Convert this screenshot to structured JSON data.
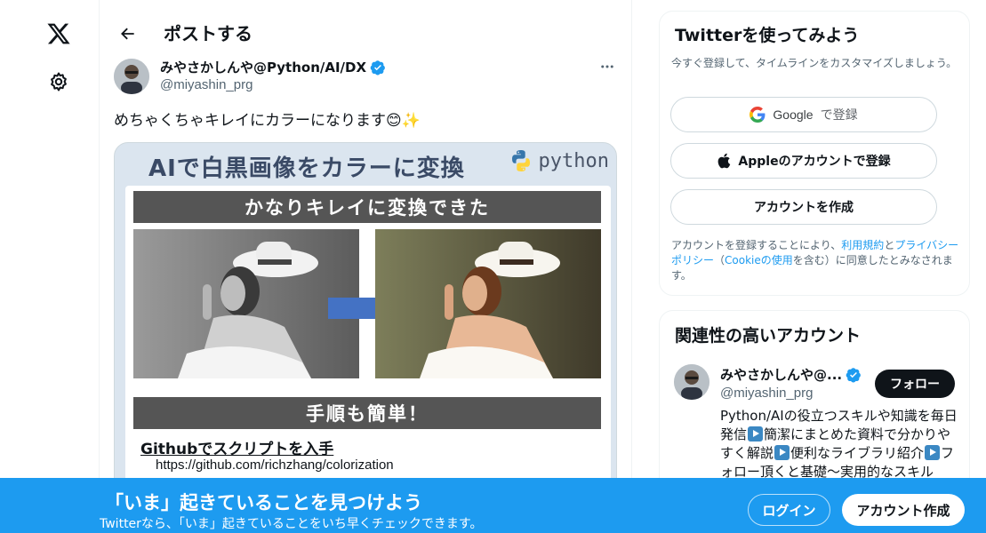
{
  "nav": {
    "logo_icon": "x-logo-icon",
    "settings_icon": "gear-icon"
  },
  "header": {
    "title": "ポストする",
    "back_icon": "arrow-left-icon"
  },
  "post": {
    "author_name": "みやさかしんや@Python/AI/DX",
    "author_handle": "@miyashin_prg",
    "verified": true,
    "text": "めちゃくちゃキレイにカラーになります😊✨",
    "media": {
      "title": "AIで白黒画像をカラーに変換",
      "python_label": "python",
      "banner_top": "かなりキレイに変換できた",
      "banner_bottom": "手順も簡単！",
      "github_title": "Githubでスクリプトを入手",
      "github_url": "https://github.com/richzhang/colorization"
    }
  },
  "signup_card": {
    "title": "Twitterを使ってみよう",
    "subtitle": "今すぐ登録して、タイムラインをカスタマイズしましょう。",
    "google_label": "Google",
    "google_suffix": "で登録",
    "apple_label": "Appleのアカウントで登録",
    "create_label": "アカウントを作成",
    "legal_prefix": "アカウントを登録することにより、",
    "terms_link": "利用規約",
    "and": "と",
    "privacy_link": "プライバシーポリシー",
    "paren_open": "（",
    "cookie_link": "Cookieの使用",
    "legal_suffix": "を含む）に同意したとみなされます。"
  },
  "related_card": {
    "title": "関連性の高いアカウント",
    "name": "みやさかしんや@...",
    "handle": "@miyashin_prg",
    "follow_label": "フォロー",
    "bio_1": "Python/AIの役立つスキルや知識を毎日発信",
    "bio_2": "簡潔にまとめた資料で分かりやすく解説",
    "bio_3": "便利なライブラリ紹介",
    "bio_4": "フォロー頂くと基礎〜実用的なスキル"
  },
  "bottom_bar": {
    "title": "「いま」起きていることを見つけよう",
    "subtitle": "Twitterなら、「いま」起きていることをいち早くチェックできます。",
    "login_label": "ログイン",
    "signup_label": "アカウント作成"
  },
  "colors": {
    "accent": "#1d9bf0",
    "verified": "#1d9bf0",
    "dark_button": "#0f1419"
  }
}
